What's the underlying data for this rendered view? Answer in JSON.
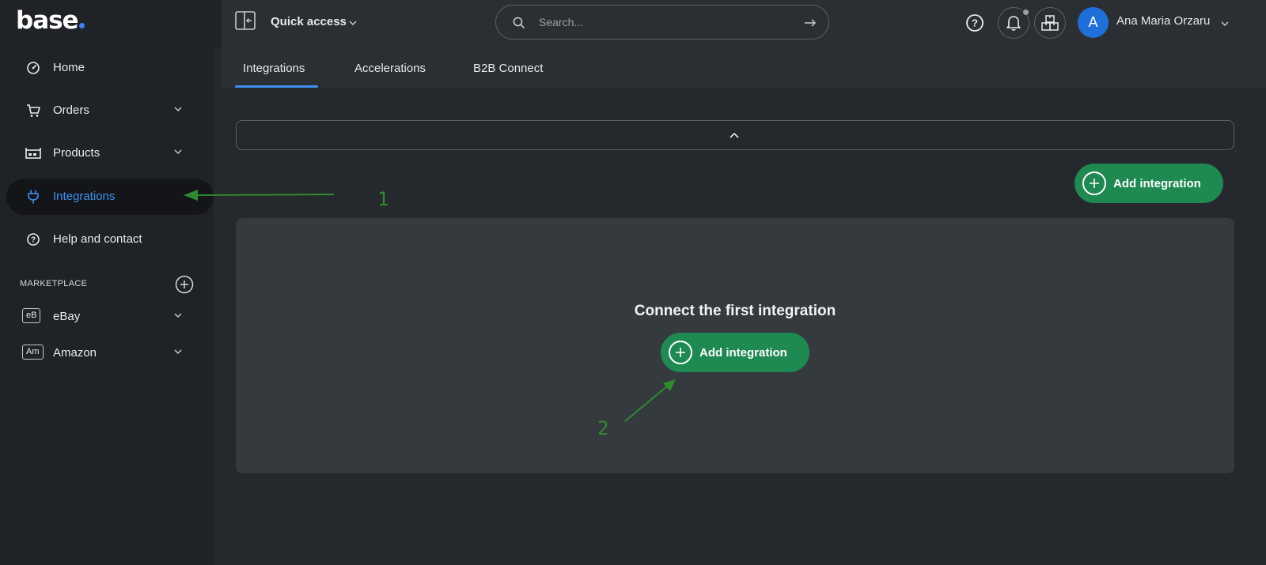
{
  "brand": {
    "logo_text": "base",
    "accent": "#3b82f6"
  },
  "sidebar": {
    "items": [
      {
        "label": "Home",
        "icon": "dashboard-icon",
        "has_chevron": false
      },
      {
        "label": "Orders",
        "icon": "cart-icon",
        "has_chevron": true
      },
      {
        "label": "Products",
        "icon": "products-icon",
        "has_chevron": true
      },
      {
        "label": "Integrations",
        "icon": "plug-icon",
        "has_chevron": false,
        "active": true
      },
      {
        "label": "Help and contact",
        "icon": "help-circle-icon",
        "has_chevron": false
      }
    ],
    "marketplace": {
      "header": "MARKETPLACE",
      "items": [
        {
          "badge": "eB",
          "label": "eBay"
        },
        {
          "badge": "Am",
          "label": "Amazon"
        }
      ]
    }
  },
  "topbar": {
    "quick_access": "Quick access",
    "search_placeholder": "Search...",
    "user_initial": "A",
    "user_name": "Ana Maria Orzaru",
    "avatar_color": "#1e6fd9"
  },
  "tabs": [
    {
      "label": "Integrations",
      "active": true
    },
    {
      "label": "Accelerations"
    },
    {
      "label": "B2B Connect"
    }
  ],
  "main": {
    "add_button_label": "Add integration",
    "empty_title": "Connect the first integration",
    "empty_button_label": "Add integration",
    "button_color": "#1e8a52"
  },
  "annotations": {
    "first": "1",
    "second": "2",
    "color": "#2e8b2e"
  }
}
